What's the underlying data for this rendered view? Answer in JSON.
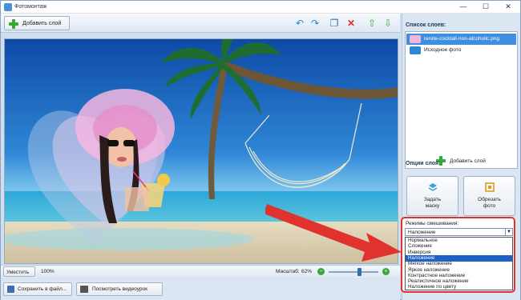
{
  "window": {
    "title": "Фотомонтаж",
    "minimize": "—",
    "maximize": "☐",
    "close": "✕"
  },
  "toolbar": {
    "add_layer_label": "Добавить слой",
    "icons": [
      "undo-icon",
      "redo-icon",
      "copy-icon",
      "delete-icon",
      "move-up-icon",
      "move-down-icon"
    ]
  },
  "zoom": {
    "fit_label": "Уместить",
    "percent_label": "100%",
    "scale_label": "Масштаб:",
    "scale_value": "62%",
    "slider_fraction": 0.62
  },
  "bottom": {
    "save_label": "Сохранить в файл...",
    "video_label": "Посмотреть видеоурок"
  },
  "layers_panel": {
    "title": "Список слоев:",
    "items": [
      {
        "name": "rerete-cocktail-non-alcoholic.png",
        "selected": true
      },
      {
        "name": "Исходное фото",
        "selected": false
      }
    ],
    "add_layer_label": "Добавить слой"
  },
  "options_panel": {
    "title": "Опции слоя:",
    "mask_label_1": "Задать",
    "mask_label_2": "маску",
    "crop_label_1": "Обрезать",
    "crop_label_2": "фото"
  },
  "blend": {
    "label": "Режимы смешивания:",
    "selected": "Наложение",
    "options": [
      "Нормальное",
      "Сложение",
      "Инверсия",
      "Наложение",
      "Мягкое наложение",
      "Яркое наложение",
      "Контрастное наложение",
      "Реалистичное наложение",
      "Наложение по цвету"
    ],
    "selected_index": 3
  },
  "colors": {
    "accent": "#3e8fe0",
    "highlight": "#1e62c8",
    "annotation_red": "#e0332e",
    "add_green": "#35a93a"
  }
}
